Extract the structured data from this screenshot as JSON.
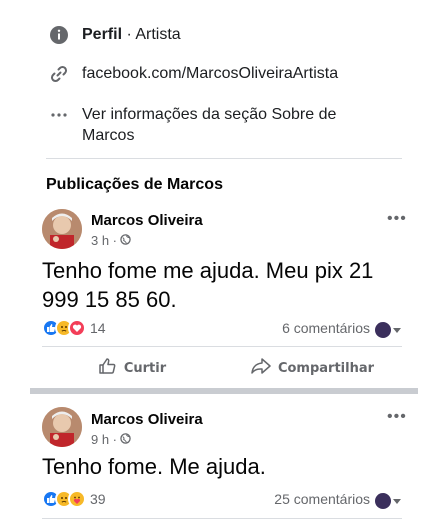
{
  "about": {
    "profile_label": "Perfil",
    "profile_separator": "·",
    "profile_category": "Artista",
    "link": "facebook.com/MarcosOliveiraArtista",
    "more_info": "Ver informações da seção Sobre de Marcos"
  },
  "section_title": "Publicações de Marcos",
  "posts": [
    {
      "author": "Marcos Oliveira",
      "time": "3 h ·",
      "text": "Tenho fome me ajuda. Meu pix 21 999 15 85 60.",
      "reaction_count": "14",
      "comments": "6 comentários",
      "reactions": [
        "like",
        "sad",
        "love"
      ],
      "actions": {
        "like": "Curtir",
        "share": "Compartilhar"
      }
    },
    {
      "author": "Marcos Oliveira",
      "time": "9 h ·",
      "text": "Tenho fome. Me ajuda.",
      "reaction_count": "39",
      "comments": "25 comentários",
      "reactions": [
        "like",
        "sad",
        "care"
      ]
    }
  ],
  "more_button": "•••",
  "icons": {
    "info": "info-icon",
    "link": "link-icon",
    "more": "more-horizontal-icon",
    "globe": "globe-icon",
    "like_action": "thumbs-up-icon",
    "share_action": "share-arrow-icon"
  },
  "colors": {
    "like_blue": "#1877f2",
    "love_red": "#f33e58",
    "sad_yellow": "#f7b928",
    "muted_text": "#65676b"
  }
}
